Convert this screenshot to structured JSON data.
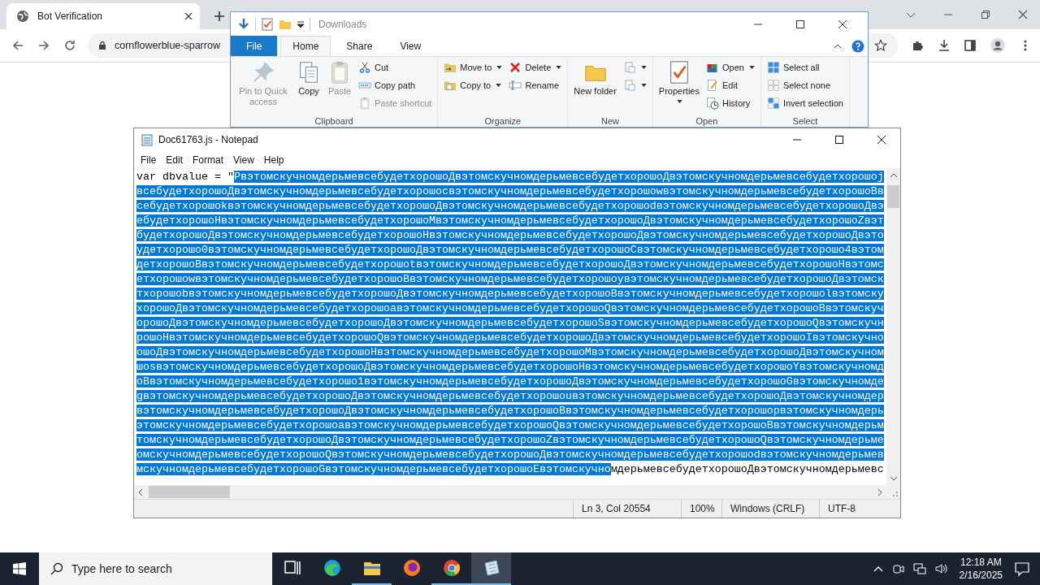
{
  "browser": {
    "tab": {
      "title": "Bot Verification"
    },
    "url": "cornflowerblue-sparrow"
  },
  "explorer": {
    "title": "Downloads",
    "tabs": [
      {
        "label": "File",
        "kind": "file",
        "selected": false
      },
      {
        "label": "Home",
        "kind": "tab",
        "selected": true
      },
      {
        "label": "Share",
        "kind": "tab",
        "selected": false
      },
      {
        "label": "View",
        "kind": "tab",
        "selected": false
      }
    ],
    "groups": [
      {
        "label": "Clipboard",
        "columns": [
          [
            {
              "label": "Pin to Quick access",
              "kind": "large",
              "disabled": true
            }
          ],
          [
            {
              "label": "Copy",
              "kind": "large",
              "disabled": false
            }
          ],
          [
            {
              "label": "Paste",
              "kind": "large",
              "disabled": true
            }
          ],
          [
            {
              "label": "Cut",
              "kind": "small",
              "disabled": false
            },
            {
              "label": "Copy path",
              "kind": "small",
              "disabled": false
            },
            {
              "label": "Paste shortcut",
              "kind": "small",
              "disabled": true
            }
          ]
        ]
      },
      {
        "label": "Organize",
        "columns": [
          [
            {
              "label": "Move to",
              "kind": "small",
              "disabled": false,
              "dropdown": true
            },
            {
              "label": "Copy to",
              "kind": "small",
              "disabled": false,
              "dropdown": true
            }
          ],
          [
            {
              "label": "Delete",
              "kind": "small",
              "disabled": false,
              "dropdown": true
            },
            {
              "label": "Rename",
              "kind": "small",
              "disabled": false
            }
          ]
        ]
      },
      {
        "label": "New",
        "columns": [
          [
            {
              "label": "New folder",
              "kind": "large",
              "disabled": false
            }
          ],
          [
            {
              "kind": "small",
              "disabled": false,
              "dropdown": true
            },
            {
              "kind": "small",
              "disabled": false,
              "dropdown": true
            }
          ]
        ]
      },
      {
        "label": "Open",
        "columns": [
          [
            {
              "label": "Properties",
              "kind": "large",
              "disabled": false,
              "dropdown": true
            }
          ],
          [
            {
              "label": "Open",
              "kind": "small",
              "disabled": false,
              "dropdown": true
            },
            {
              "label": "Edit",
              "kind": "small",
              "disabled": false
            },
            {
              "label": "History",
              "kind": "small",
              "disabled": false
            }
          ]
        ]
      },
      {
        "label": "Select",
        "columns": [
          [
            {
              "label": "Select all",
              "kind": "small",
              "disabled": false
            },
            {
              "label": "Select none",
              "kind": "small",
              "disabled": false
            },
            {
              "label": "Invert selection",
              "kind": "small",
              "disabled": false
            }
          ]
        ]
      }
    ]
  },
  "notepad": {
    "title": "Doc61763.js - Notepad",
    "menu": [
      "File",
      "Edit",
      "Format",
      "View",
      "Help"
    ],
    "lines": [
      {
        "segments": [
          {
            "text": "var dbvalue = \"",
            "selected": false
          },
          {
            "text": "PвэтомскучномдерьмевсебудетхорошоДвэтомскучномдерьмевсебудетхорошоДвэтомскучномдерьмевсебудетхорошоj",
            "selected": true
          }
        ]
      },
      {
        "segments": [
          {
            "text": "всебудетхорошоДвэтомскучномдерьмевсебудетхорошоcвэтомскучномдерьмевсебудетхорошоwвэтомскучномдерьмевсебудетхорошоBв",
            "selected": true
          }
        ]
      },
      {
        "segments": [
          {
            "text": "себудетхорошоkвэтомскучномдерьмевсебудетхорошоДвэтомскучномдерьмевсебудетхорошоdвэтомскучномдерьмевсебудетхорошоДвэ",
            "selected": true
          }
        ]
      },
      {
        "segments": [
          {
            "text": "ебудетхорошоHвэтомскучномдерьмевсебудетхорошоMвэтомскучномдерьмевсебудетхорошоДвэтомскучномдерьмевсебудетхорошоZвэт",
            "selected": true
          }
        ]
      },
      {
        "segments": [
          {
            "text": "будетхорошоДвэтомскучномдерьмевсебудетхорошоHвэтомскучномдерьмевсебудетхорошоДвэтомскучномдерьмевсебудетхорошоДвэто",
            "selected": true
          }
        ]
      },
      {
        "segments": [
          {
            "text": "удетхорошо0вэтомскучномдерьмевсебудетхорошоДвэтомскучномдерьмевсебудетхорошоCвэтомскучномдерьмевсебудетхорошо4вэтом",
            "selected": true
          }
        ]
      },
      {
        "segments": [
          {
            "text": "детхорошоBвэтомскучномдерьмевсебудетхорошоtвэтомскучномдерьмевсебудетхорошоДвэтомскучномдерьмевсебудетхорошоHвэтомс",
            "selected": true
          }
        ]
      },
      {
        "segments": [
          {
            "text": "етхорошоwвэтомскучномдерьмевсебудетхорошоBвэтомскучномдерьмевсебудетхорошоyвэтомскучномдерьмевсебудетхорошоДвэтомск",
            "selected": true
          }
        ]
      },
      {
        "segments": [
          {
            "text": "тхорошоbвэтомскучномдерьмевсебудетхорошоДвэтомскучномдерьмевсебудетхорошоBвэтомскучномдерьмевсебудетхорошоlвэтомску",
            "selected": true
          }
        ]
      },
      {
        "segments": [
          {
            "text": "хорошоДвэтомскучномдерьмевсебудетхорошоaвэтомскучномдерьмевсебудетхорошоQвэтомскучномдерьмевсебудетхорошоBвэтомскуч",
            "selected": true
          }
        ]
      },
      {
        "segments": [
          {
            "text": "орошоДвэтомскучномдерьмевсебудетхорошоДвэтомскучномдерьмевсебудетхорошоSвэтомскучномдерьмевсебудетхорошоQвэтомскучн",
            "selected": true
          }
        ]
      },
      {
        "segments": [
          {
            "text": "рошоHвэтомскучномдерьмевсебудетхорошоQвэтомскучномдерьмевсебудетхорошоДвэтомскучномдерьмевсебудетхорошоIвэтомскучно",
            "selected": true
          }
        ]
      },
      {
        "segments": [
          {
            "text": "ошоДвэтомскучномдерьмевсебудетхорошоHвэтомскучномдерьмевсебудетхорошоMвэтомскучномдерьмевсебудетхорошоДвэтомскучном",
            "selected": true
          }
        ]
      },
      {
        "segments": [
          {
            "text": "шоsвэтомскучномдерьмевсебудетхорошоДвэтомскучномдерьмевсебудетхорошоHвэтомскучномдерьмевсебудетхорошоYвэтомскучномд",
            "selected": true
          }
        ]
      },
      {
        "segments": [
          {
            "text": "оBвэтомскучномдерьмевсебудетхорошо1вэтомскучномдерьмевсебудетхорошоДвэтомскучномдерьмевсебудетхорошоGвэтомскучномде",
            "selected": true
          }
        ]
      },
      {
        "segments": [
          {
            "text": "gвэтомскучномдерьмевсебудетхорошоДвэтомскучномдерьмевсебудетхорошоuвэтомскучномдерьмевсебудетхорошоДвэтомскучномдер",
            "selected": true
          }
        ]
      },
      {
        "segments": [
          {
            "text": "вэтомскучномдерьмевсебудетхорошоДвэтомскучномдерьмевсебудетхорошоBвэтомскучномдерьмевсебудетхорошоpвэтомскучномдерь",
            "selected": true
          }
        ]
      },
      {
        "segments": [
          {
            "text": "этомскучномдерьмевсебудетхорошоaвэтомскучномдерьмевсебудетхорошоQвэтомскучномдерьмевсебудетхорошоBвэтомскучномдерьм",
            "selected": true
          }
        ]
      },
      {
        "segments": [
          {
            "text": "томскучномдерьмевсебудетхорошоДвэтомскучномдерьмевсебудетхорошоZвэтомскучномдерьмевсебудетхорошоQвэтомскучномдерьме",
            "selected": true
          }
        ]
      },
      {
        "segments": [
          {
            "text": "омскучномдерьмевсебудетхорошоQвэтомскучномдерьмевсебудетхорошоДвэтомскучномдерьмевсебудетхорошоdвэтомскучномдерьмев",
            "selected": true
          }
        ]
      },
      {
        "segments": [
          {
            "text": "мскучномдерьмевсебудетхорошоGвэтомскучномдерьмевсебудетхорошоEвэтомскучно",
            "selected": true
          },
          {
            "text": "мдерьмевсебудетхорошоДвэтомскучномдерьмевс",
            "selected": false
          }
        ]
      }
    ],
    "status": [
      "Ln 3, Col 20554",
      "100%",
      "Windows (CRLF)",
      "UTF-8"
    ]
  },
  "taskbar": {
    "search": {
      "placeholder": "Type here to search"
    },
    "apps": [
      {
        "running": false,
        "selected": false
      },
      {
        "running": false,
        "selected": false
      },
      {
        "running": true,
        "selected": false
      },
      {
        "running": false,
        "selected": false
      },
      {
        "running": true,
        "selected": false
      },
      {
        "running": true,
        "selected": true
      }
    ],
    "time": "12:18 AM",
    "date": "2/16/2025"
  }
}
